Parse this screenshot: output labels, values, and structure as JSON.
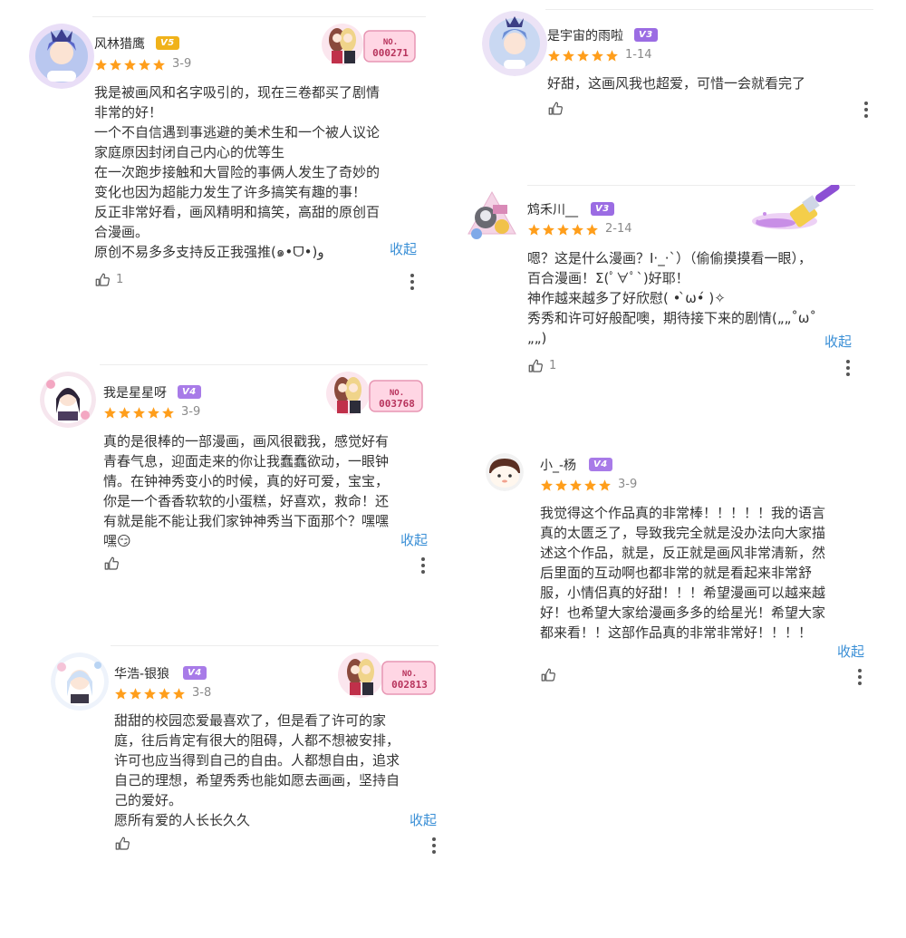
{
  "colors": {
    "star": "#ff9e1b",
    "badge_v5": "#f0b21a",
    "badge_v4": "#a87be8",
    "badge_v3": "#9b6ce3",
    "link": "#3a8fd6",
    "divider": "#ececec"
  },
  "icons": {
    "like": "thumbs-up-icon",
    "more": "more-vertical-icon",
    "star": "star-icon"
  },
  "reviews": [
    {
      "username": "风林猎鹰",
      "badge": "V5",
      "rating": 5,
      "date": "3-9",
      "text": "我是被画风和名字吸引的，现在三卷都买了剧情\n非常的好！\n一个不自信遇到事逃避的美术生和一个被人议论\n家庭原因封闭自己内心的优等生\n在一次跑步接触和大冒险的事俩人发生了奇妙的\n变化也因为超能力发生了许多搞笑有趣的事！\n反正非常好看，画风精明和搞笑，高甜的原创百\n合漫画。\n原创不易多多支持反正我强推(๑•ᗜ•)و",
      "collapse": "收起",
      "likes": "1",
      "deco_label": "NO.",
      "deco_number": "000271"
    },
    {
      "username": "是宇宙的雨啦",
      "badge": "V3",
      "rating": 5,
      "date": "1-14",
      "text": "好甜，这画风我也超爱，可惜一会就看完了",
      "collapse": "",
      "likes": ""
    },
    {
      "username": "鸩禾川__",
      "badge": "V3",
      "rating": 5,
      "date": "2-14",
      "text": "嗯？这是什么漫画？I·_·`）（偷偷摸摸看一眼），\n百合漫画！Σ(ﾟ∀ﾟ`)好耶！\n神作越来越多了好欣慰( • ̀ω•́ )✧\n秀秀和许可好般配噢，期待接下来的剧情(„„˚ω˚\n„„)",
      "collapse": "收起",
      "likes": "1"
    },
    {
      "username": "我是星星呀",
      "badge": "V4",
      "rating": 5,
      "date": "3-9",
      "text": "真的是很棒的一部漫画，画风很戳我，感觉好有\n青春气息，迎面走来的你让我蠢蠢欲动，一眼钟\n情。在钟神秀变小的时候，真的好可爱，宝宝，\n你是一个香香软软的小蛋糕，好喜欢，救命！还\n有就是能不能让我们家钟神秀当下面那个？嘿嘿\n嘿😏",
      "collapse": "收起",
      "likes": "",
      "deco_label": "NO.",
      "deco_number": "003768"
    },
    {
      "username": "小_-杨",
      "badge": "V4",
      "rating": 5,
      "date": "3-9",
      "text": "我觉得这个作品真的非常棒！！！！！我的语言\n真的太匮乏了，导致我完全就是没办法向大家描\n述这个作品，就是，反正就是画风非常清新，然\n后里面的互动啊也都非常的就是看起来非常舒\n服，小情侣真的好甜！！！希望漫画可以越来越\n好！也希望大家给漫画多多的给星光！希望大家\n都来看！！这部作品真的非常非常好！！！！",
      "collapse": "收起",
      "likes": ""
    },
    {
      "username": "华浩-银狼",
      "badge": "V4",
      "rating": 5,
      "date": "3-8",
      "text": "甜甜的校园恋爱最喜欢了，但是看了许可的家\n庭，往后肯定有很大的阻碍，人都不想被安排，\n许可也应当得到自己的自由。人都想自由，追求\n自己的理想，希望秀秀也能如愿去画画，坚持自\n己的爱好。\n愿所有爱的人长长久久",
      "collapse": "收起",
      "likes": "",
      "deco_label": "NO.",
      "deco_number": "002813"
    }
  ]
}
